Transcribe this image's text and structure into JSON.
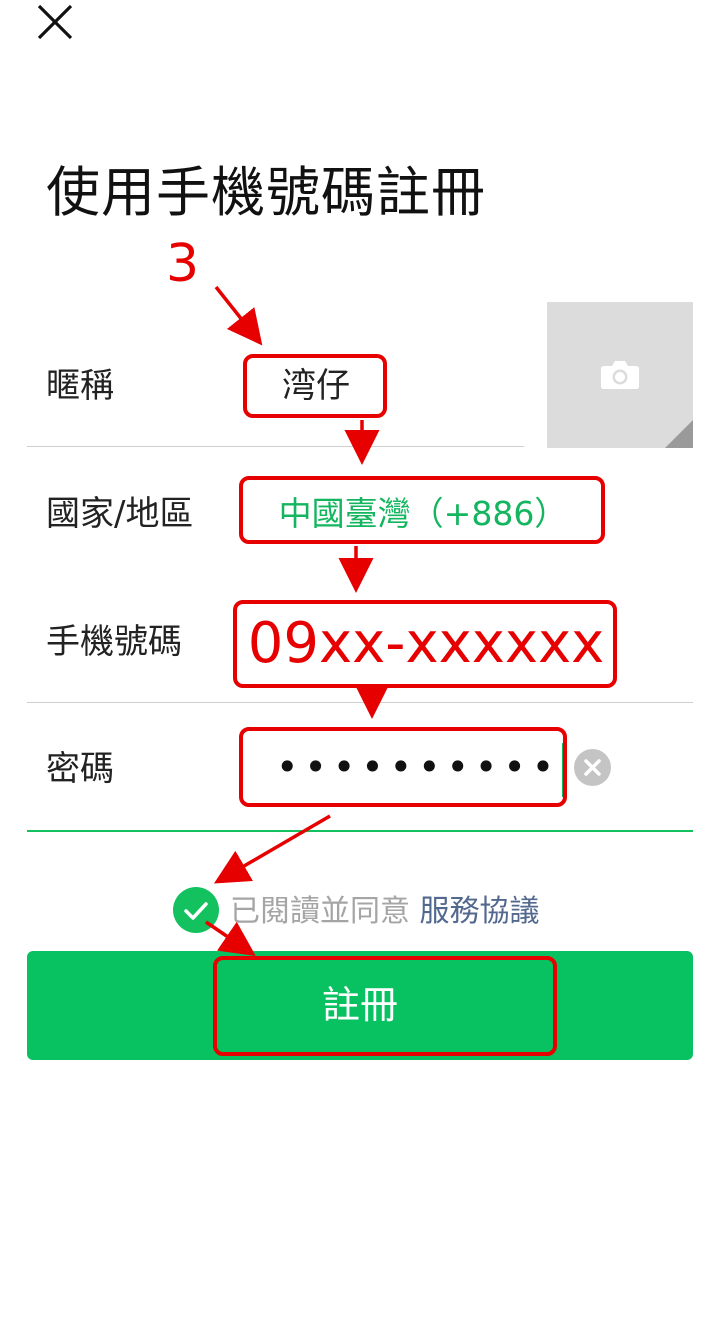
{
  "header": {
    "close_icon": "close-icon",
    "title": "使用手機號碼註冊"
  },
  "annotation": {
    "step_number": "3",
    "color": "#e60000"
  },
  "form": {
    "nickname": {
      "label": "暱稱",
      "value": "湾仔"
    },
    "photo": {
      "icon": "camera-icon"
    },
    "country": {
      "label": "國家/地區",
      "value": "中國臺灣（+886）"
    },
    "phone": {
      "label": "手機號碼",
      "value": "09xx-xxxxxx"
    },
    "password": {
      "label": "密碼",
      "value": "••••••••••",
      "clear_icon": "clear-icon"
    }
  },
  "agreement": {
    "checked": true,
    "text": "已閱讀並同意",
    "link": "服務協議"
  },
  "register_button": {
    "label": "註冊"
  },
  "colors": {
    "accent": "#08c160",
    "country_text": "#13b55e",
    "link": "#53688f",
    "annotation_red": "#e60000"
  }
}
